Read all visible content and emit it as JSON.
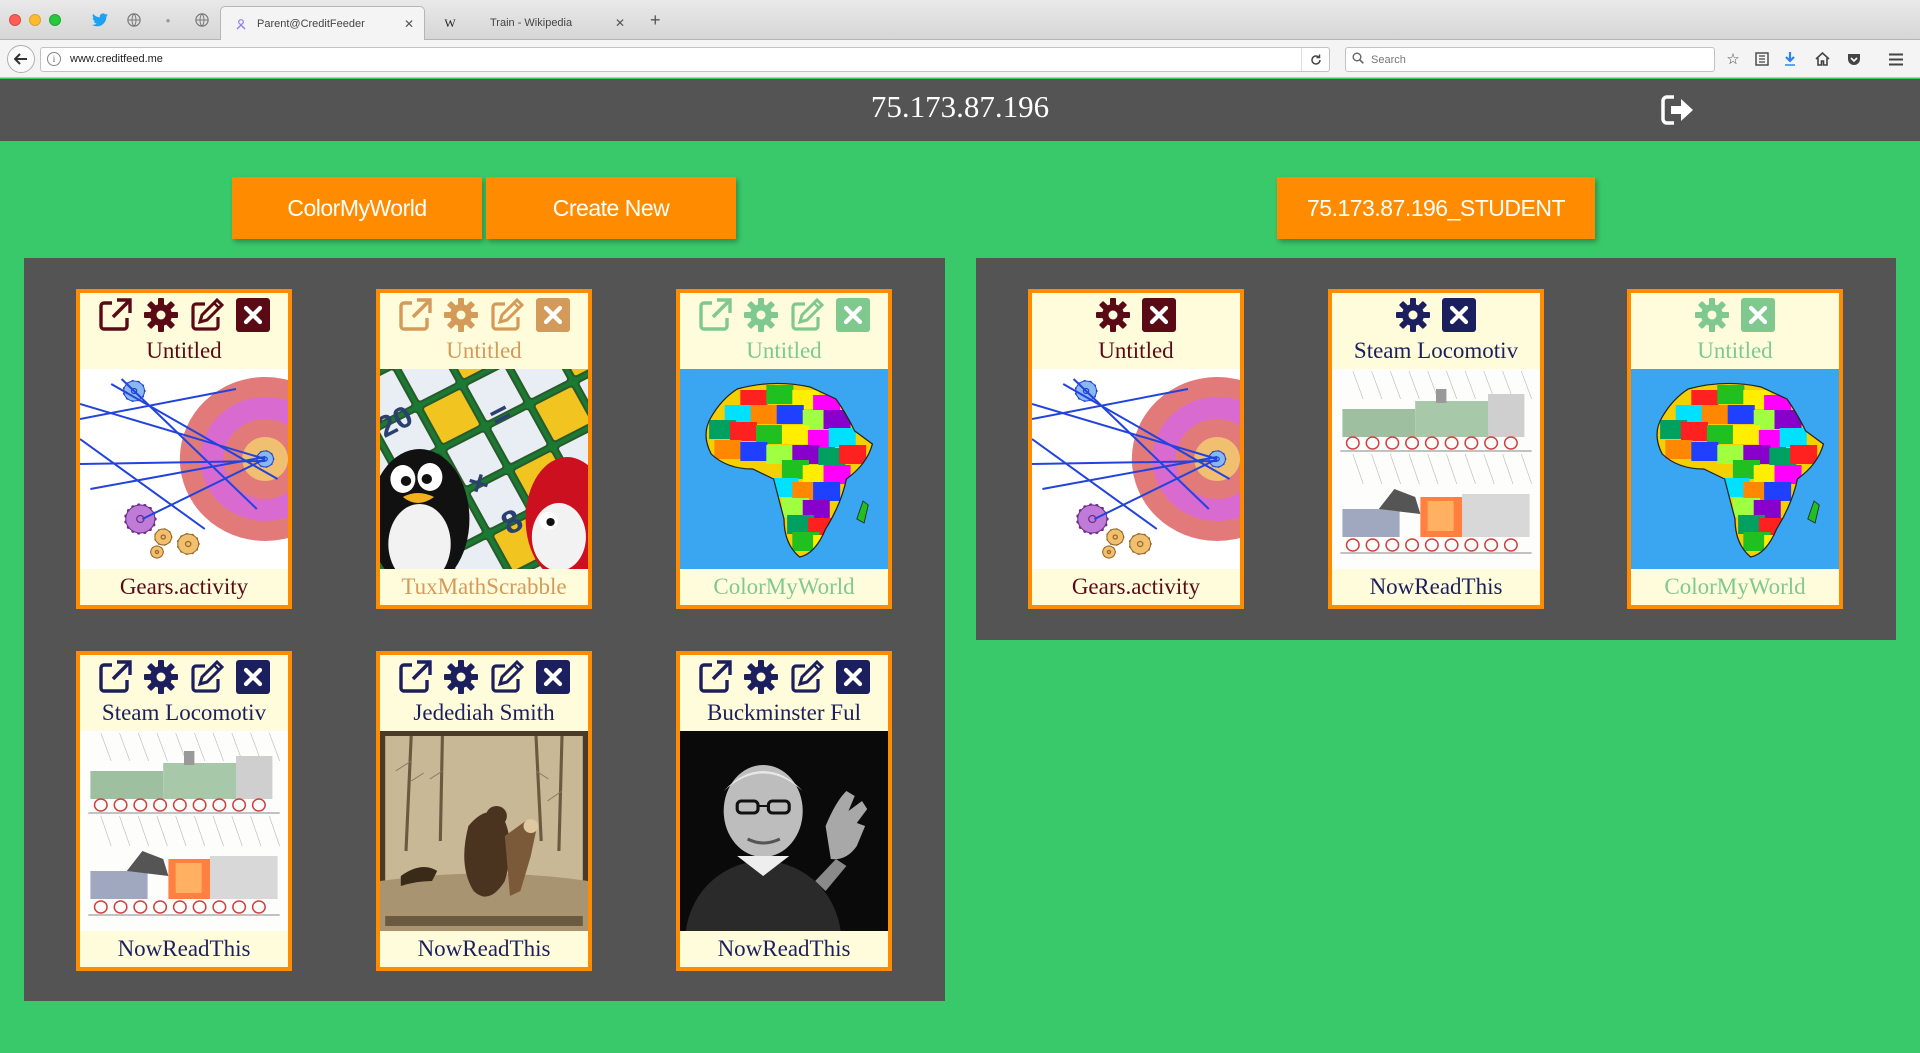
{
  "browser": {
    "tabs": [
      {
        "label": "Parent@CreditFeeder",
        "active": true,
        "favicon": "sugar-icon"
      },
      {
        "label": "Train - Wikipedia",
        "active": false,
        "favicon": "wikipedia-icon"
      }
    ],
    "wikipedia_glyph": "W",
    "url": "www.creditfeed.me",
    "search_placeholder": "Search"
  },
  "header": {
    "title": "75.173.87.196",
    "logout_icon": "sign-out-icon"
  },
  "actions": {
    "colormyworld_label": "ColorMyWorld",
    "create_new_label": "Create New",
    "student_label": "75.173.87.196_STUDENT"
  },
  "colors": {
    "background": "#3ac96a",
    "panel": "#545454",
    "accent": "#ff8c00",
    "card_bg": "#fffcdc",
    "text_maroon": "#5a0a14",
    "text_navy": "#1c1f5e",
    "text_tan": "#d49a5a",
    "text_green": "#7fc98f"
  },
  "parent_cards": [
    {
      "title": "Untitled",
      "activity": "Gears.activity",
      "theme": "maroon",
      "thumbnail": "gears",
      "icons": [
        "launch-icon",
        "gear-icon",
        "edit-icon",
        "delete-icon"
      ]
    },
    {
      "title": "Untitled",
      "activity": "TuxMathScrabble",
      "theme": "tan",
      "thumbnail": "tuxmath",
      "icons": [
        "launch-icon",
        "gear-icon",
        "edit-icon",
        "delete-icon"
      ]
    },
    {
      "title": "Untitled",
      "activity": "ColorMyWorld",
      "theme": "green",
      "thumbnail": "africa-map",
      "icons": [
        "launch-icon",
        "gear-icon",
        "edit-icon",
        "delete-icon"
      ]
    },
    {
      "title": "Steam Locomotiv",
      "activity": "NowReadThis",
      "theme": "navy",
      "thumbnail": "locomotive",
      "icons": [
        "launch-icon",
        "gear-icon",
        "edit-icon",
        "delete-icon"
      ]
    },
    {
      "title": "Jedediah Smith",
      "activity": "NowReadThis",
      "theme": "navy",
      "thumbnail": "bear-engraving",
      "icons": [
        "launch-icon",
        "gear-icon",
        "edit-icon",
        "delete-icon"
      ]
    },
    {
      "title": "Buckminster Ful",
      "activity": "NowReadThis",
      "theme": "navy",
      "thumbnail": "portrait",
      "icons": [
        "launch-icon",
        "gear-icon",
        "edit-icon",
        "delete-icon"
      ]
    }
  ],
  "student_cards": [
    {
      "title": "Untitled",
      "activity": "Gears.activity",
      "theme": "maroon",
      "thumbnail": "gears",
      "icons": [
        "gear-icon",
        "delete-icon"
      ]
    },
    {
      "title": "Steam Locomotiv",
      "activity": "NowReadThis",
      "theme": "navy",
      "thumbnail": "locomotive",
      "icons": [
        "gear-icon",
        "delete-icon"
      ]
    },
    {
      "title": "Untitled",
      "activity": "ColorMyWorld",
      "theme": "green",
      "thumbnail": "africa-map",
      "icons": [
        "gear-icon",
        "delete-icon"
      ]
    }
  ]
}
